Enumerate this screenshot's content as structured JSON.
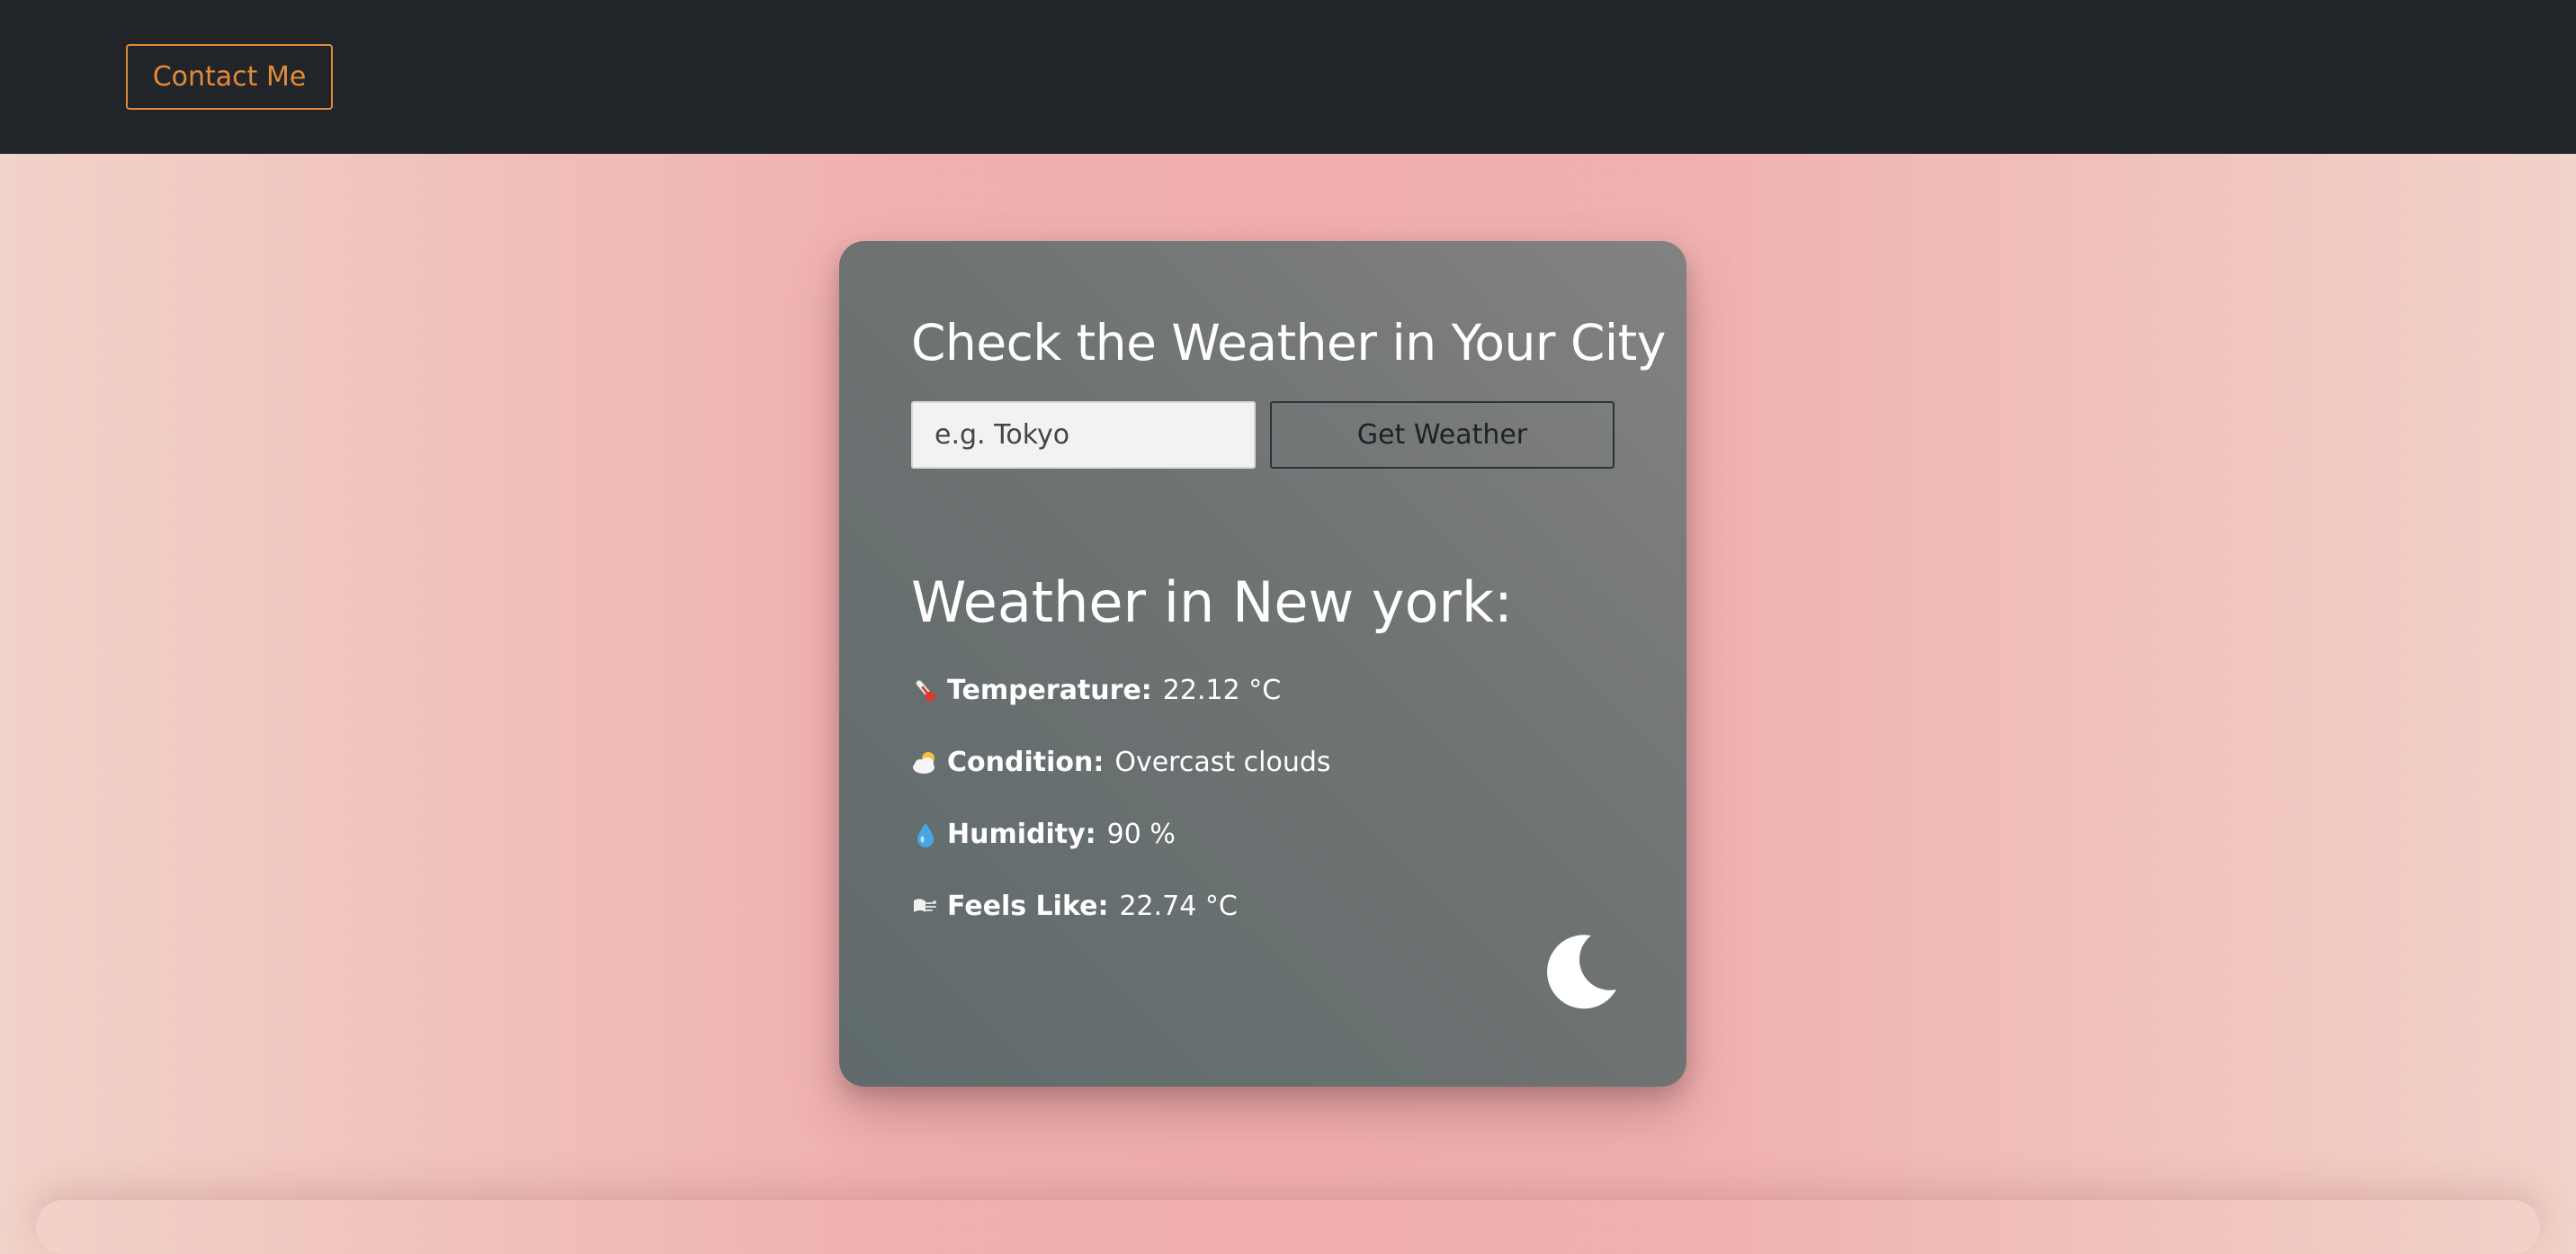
{
  "nav": {
    "contact_label": "Contact Me",
    "accent_color": "#e28a3a",
    "background_color": "#212529"
  },
  "search": {
    "title": "Check the Weather in Your City",
    "placeholder": "e.g. Tokyo",
    "value": "",
    "button_label": "Get Weather"
  },
  "result": {
    "title": "Weather in New york:",
    "rows": [
      {
        "icon": "thermometer-icon",
        "label": "Temperature:",
        "value": "22.12 °C"
      },
      {
        "icon": "cloud-sun-icon",
        "label": "Condition:",
        "value": "Overcast clouds"
      },
      {
        "icon": "droplet-icon",
        "label": "Humidity:",
        "value": "90 %"
      },
      {
        "icon": "wind-icon",
        "label": "Feels Like:",
        "value": "22.74 °C"
      }
    ]
  },
  "theme_toggle": {
    "icon": "moon-icon"
  }
}
